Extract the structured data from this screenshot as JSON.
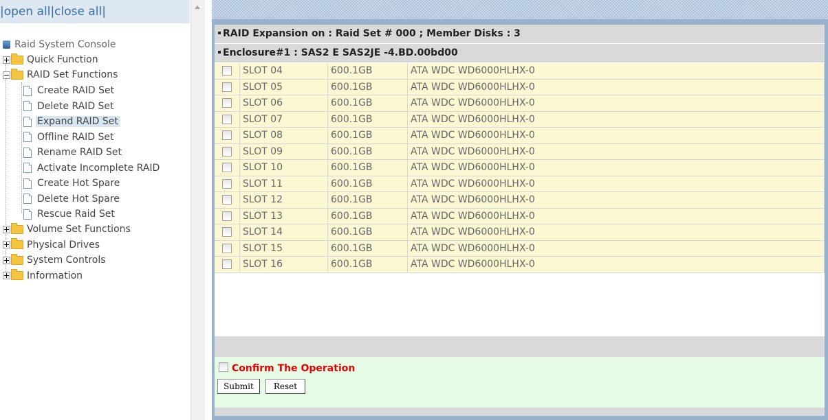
{
  "left_panel": {
    "top_links": {
      "open_all": "open all",
      "close_all": "close all",
      "sep": "|"
    },
    "tree": {
      "root": "Raid System Console",
      "quick_function": "Quick Function",
      "raid_set_functions": "RAID Set Functions",
      "raid_items": [
        "Create RAID Set",
        "Delete RAID Set",
        "Expand RAID Set",
        "Offline RAID Set",
        "Rename RAID Set",
        "Activate Incomplete RAID",
        "Create Hot Spare",
        "Delete Hot Spare",
        "Rescue Raid Set"
      ],
      "selected_item": "Expand RAID Set",
      "volume_set_functions": "Volume Set Functions",
      "physical_drives": "Physical Drives",
      "system_controls": "System Controls",
      "information": "Information"
    }
  },
  "main": {
    "header1": "RAID Expansion on : Raid Set # 000 ; Member Disks : 3",
    "header2": "Enclosure#1 : SAS2 E SAS2JE -4.BD.00bd00",
    "disks": [
      {
        "slot": "SLOT 04",
        "size": "600.1GB",
        "model": "ATA WDC WD6000HLHX-0"
      },
      {
        "slot": "SLOT 05",
        "size": "600.1GB",
        "model": "ATA WDC WD6000HLHX-0"
      },
      {
        "slot": "SLOT 06",
        "size": "600.1GB",
        "model": "ATA WDC WD6000HLHX-0"
      },
      {
        "slot": "SLOT 07",
        "size": "600.1GB",
        "model": "ATA WDC WD6000HLHX-0"
      },
      {
        "slot": "SLOT 08",
        "size": "600.1GB",
        "model": "ATA WDC WD6000HLHX-0"
      },
      {
        "slot": "SLOT 09",
        "size": "600.1GB",
        "model": "ATA WDC WD6000HLHX-0"
      },
      {
        "slot": "SLOT 10",
        "size": "600.1GB",
        "model": "ATA WDC WD6000HLHX-0"
      },
      {
        "slot": "SLOT 11",
        "size": "600.1GB",
        "model": "ATA WDC WD6000HLHX-0"
      },
      {
        "slot": "SLOT 12",
        "size": "600.1GB",
        "model": "ATA WDC WD6000HLHX-0"
      },
      {
        "slot": "SLOT 13",
        "size": "600.1GB",
        "model": "ATA WDC WD6000HLHX-0"
      },
      {
        "slot": "SLOT 14",
        "size": "600.1GB",
        "model": "ATA WDC WD6000HLHX-0"
      },
      {
        "slot": "SLOT 15",
        "size": "600.1GB",
        "model": "ATA WDC WD6000HLHX-0"
      },
      {
        "slot": "SLOT 16",
        "size": "600.1GB",
        "model": "ATA WDC WD6000HLHX-0"
      }
    ],
    "confirm_label": "Confirm The Operation",
    "submit_label": "Submit",
    "reset_label": "Reset"
  },
  "colors": {
    "row_bg": "#fcf8d3",
    "confirm_bg": "#e6fbe6",
    "confirm_text": "#e80000",
    "header_bg": "#d9d9d9",
    "frame_bg": "#9ab1cb",
    "link_color": "#3a6ea5"
  }
}
